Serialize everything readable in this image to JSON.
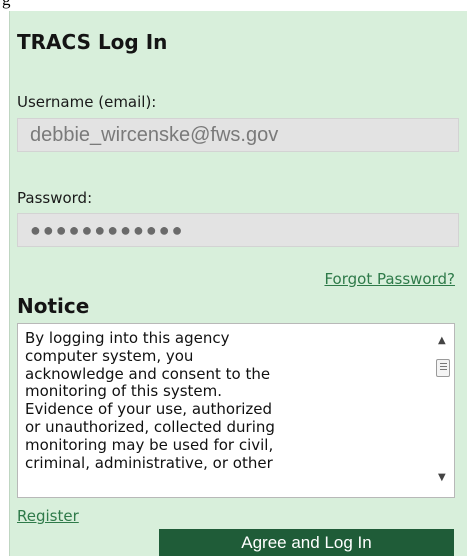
{
  "page_top_fragment": "g",
  "login": {
    "title": "TRACS Log In",
    "username_label": "Username (email):",
    "username_value": "debbie_wircenske@fws.gov",
    "password_label": "Password:",
    "password_mask": "●●●●●●●●●●●●",
    "forgot_link": "Forgot Password?"
  },
  "notice": {
    "heading": "Notice",
    "lines": [
      "By logging into this agency",
      "computer system, you",
      "acknowledge and consent to the",
      "monitoring of this system.",
      "Evidence of your use, authorized",
      "or unauthorized, collected during",
      "monitoring may be used for civil,",
      "criminal, administrative, or other"
    ],
    "scroll_position": 0
  },
  "footer": {
    "register_link": "Register",
    "submit_label": "Agree and Log In"
  },
  "colors": {
    "panel_bg": "#d8efdb",
    "link": "#2e7a49",
    "button_bg": "#1f5c38"
  }
}
